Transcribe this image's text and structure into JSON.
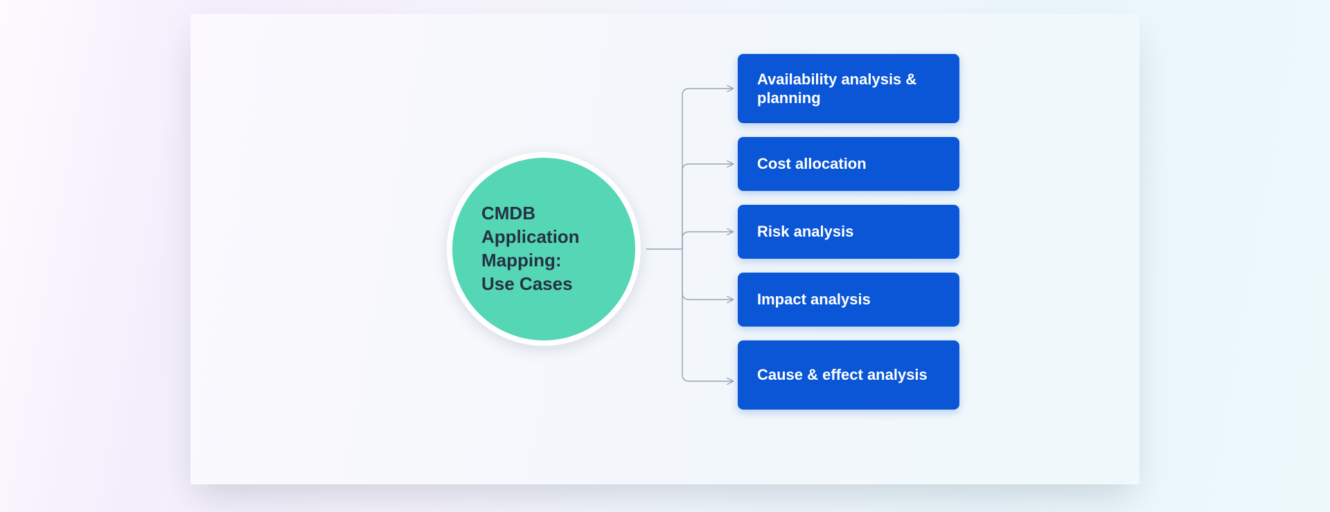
{
  "diagram": {
    "center_label": "CMDB\nApplication\nMapping:\nUse Cases",
    "items": [
      {
        "label": "Availability analysis & planning"
      },
      {
        "label": "Cost allocation"
      },
      {
        "label": "Risk analysis"
      },
      {
        "label": "Impact analysis"
      },
      {
        "label": "Cause & effect analysis"
      }
    ]
  },
  "colors": {
    "circle_fill": "#55d6b4",
    "box_fill": "#0a56d6",
    "connector": "#97a3b4"
  }
}
